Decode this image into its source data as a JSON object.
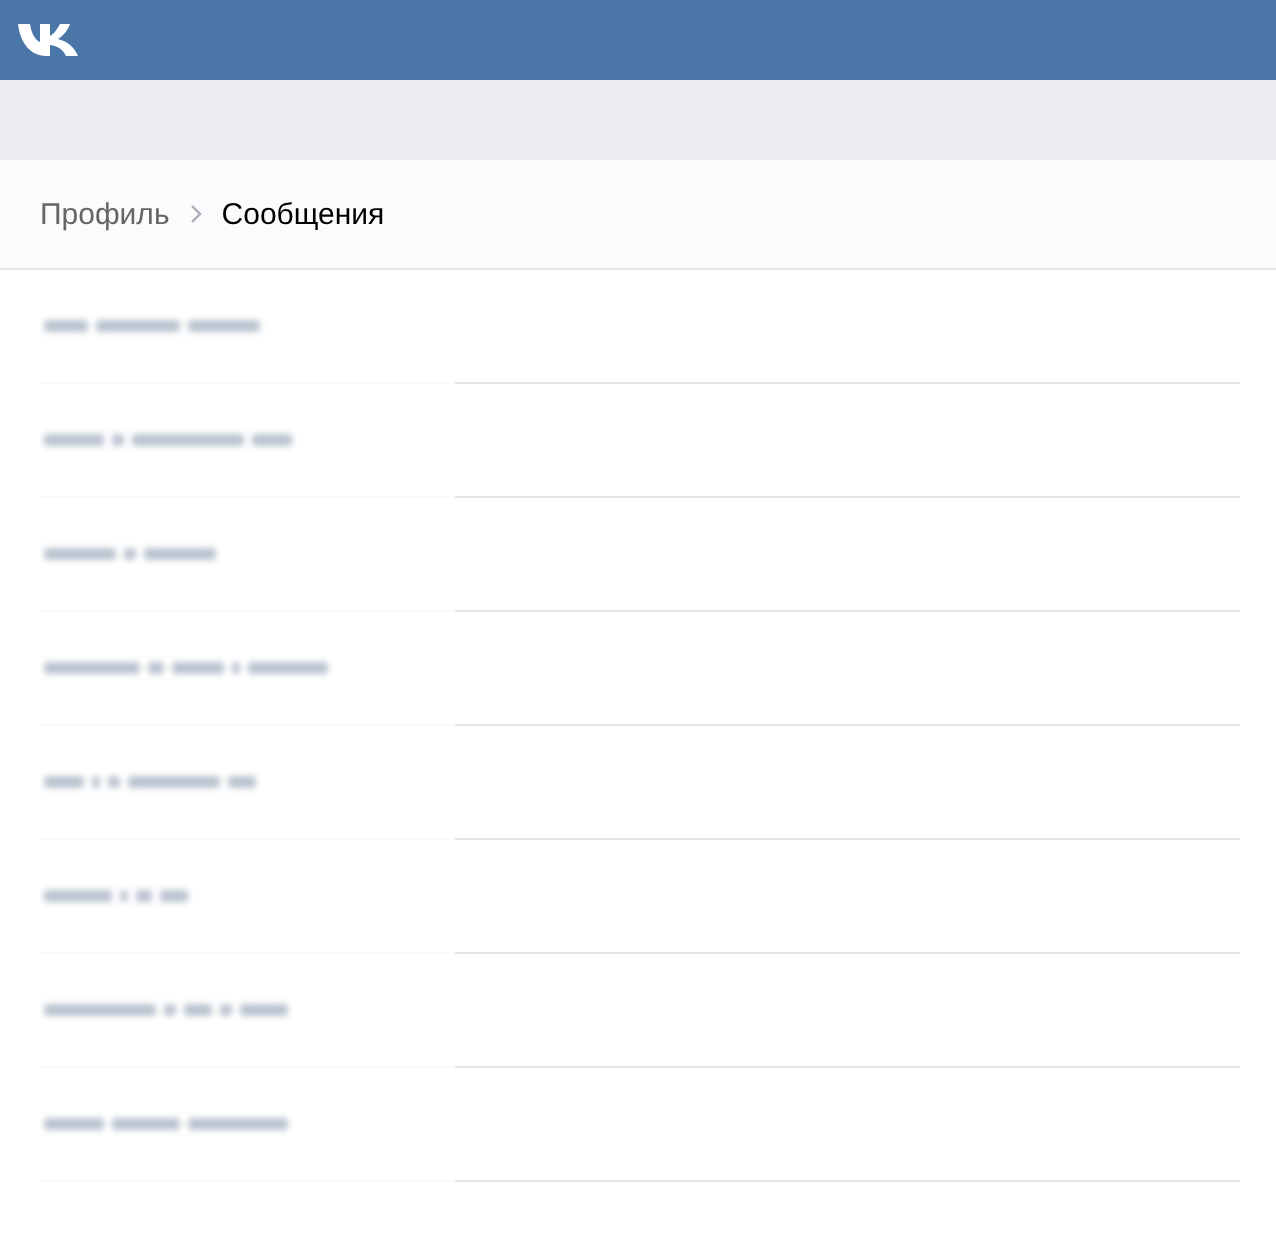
{
  "breadcrumb": {
    "items": [
      {
        "label": "Профиль",
        "current": false
      },
      {
        "label": "Сообщения",
        "current": true
      }
    ]
  },
  "conversations": [
    {
      "kind": "blurred"
    },
    {
      "kind": "blurred"
    },
    {
      "kind": "blurred"
    },
    {
      "kind": "blurred"
    },
    {
      "kind": "blurred"
    },
    {
      "kind": "blurred"
    },
    {
      "kind": "blurred"
    },
    {
      "kind": "blurred"
    }
  ]
}
